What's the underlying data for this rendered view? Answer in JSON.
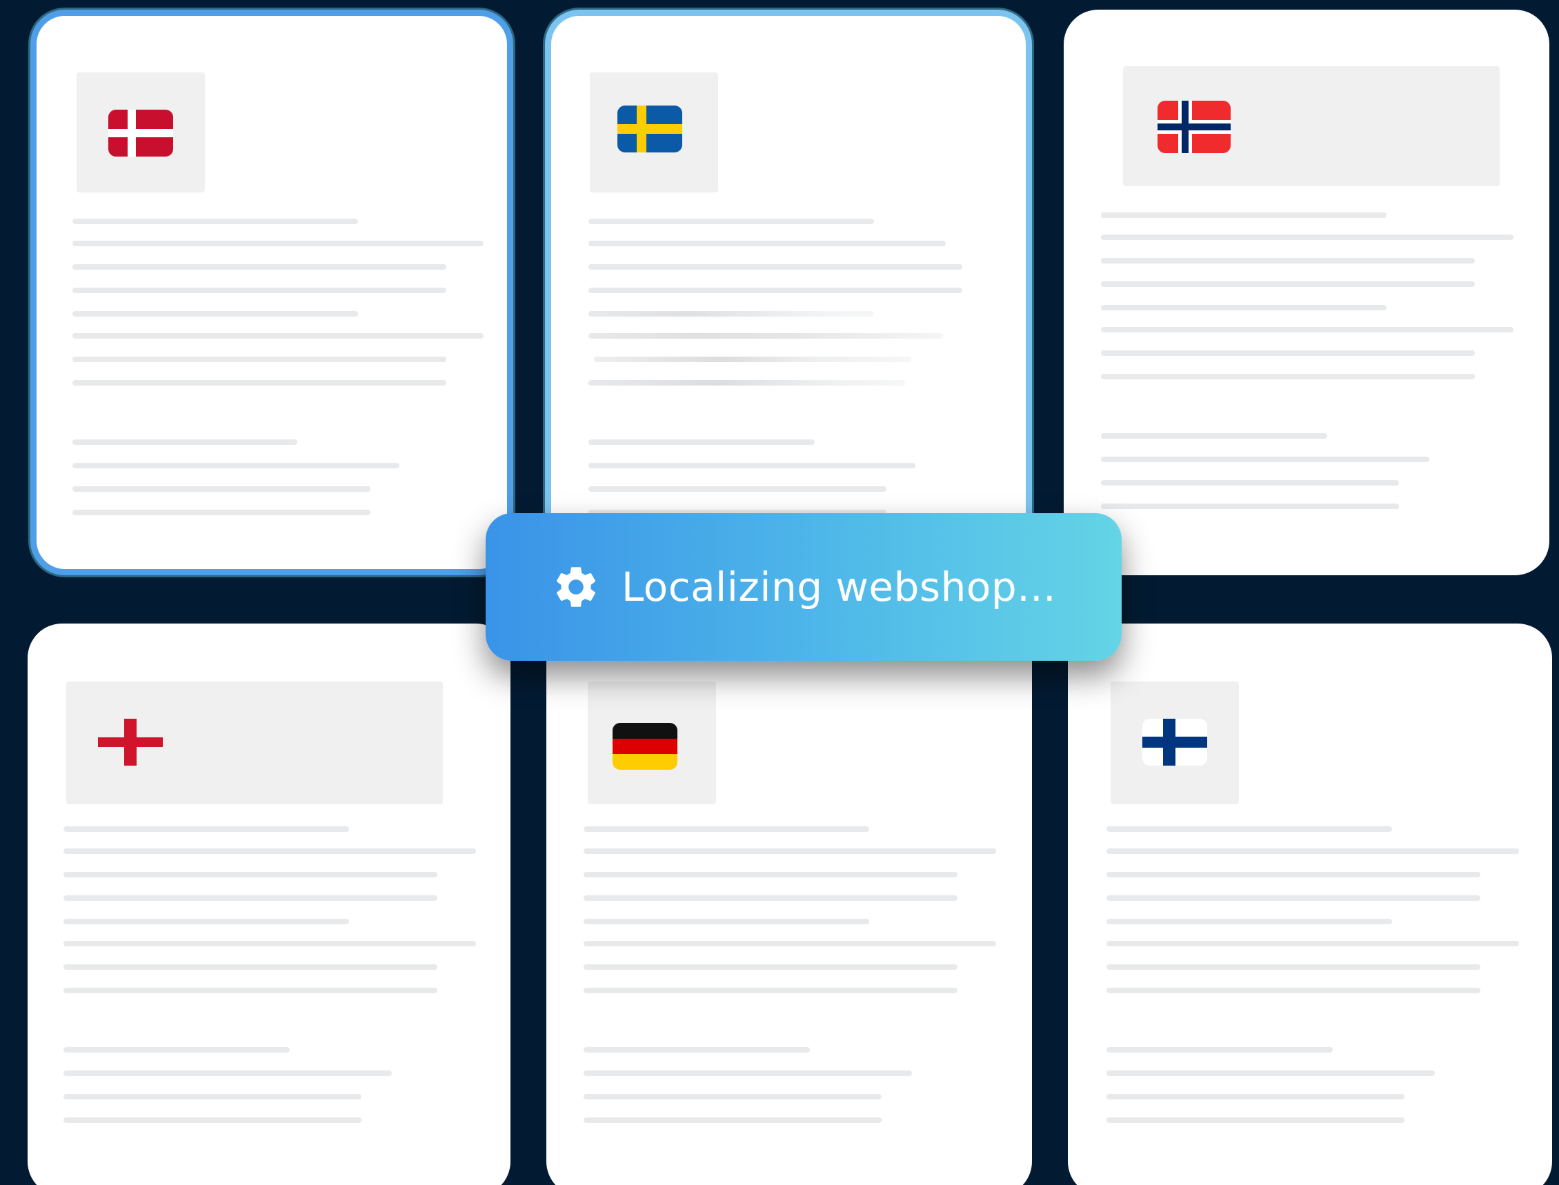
{
  "status_badge": {
    "icon": "gear-icon",
    "text": "Localizing webshop..."
  },
  "colors": {
    "background": "#031b32",
    "card": "#ffffff",
    "active_border": "#4f9fe8",
    "badge_gradient_start": "#3a93e8",
    "badge_gradient_end": "#64d4e6",
    "placeholder_line": "#e8e9eb"
  },
  "pages": [
    {
      "name": "denmark",
      "flag": "flag-denmark-icon",
      "active": true
    },
    {
      "name": "sweden",
      "flag": "flag-sweden-icon",
      "active": true
    },
    {
      "name": "norway",
      "flag": "flag-norway-icon",
      "active": false
    },
    {
      "name": "england",
      "flag": "flag-england-icon",
      "active": false
    },
    {
      "name": "germany",
      "flag": "flag-germany-icon",
      "active": false
    },
    {
      "name": "finland",
      "flag": "flag-finland-icon",
      "active": false
    }
  ]
}
